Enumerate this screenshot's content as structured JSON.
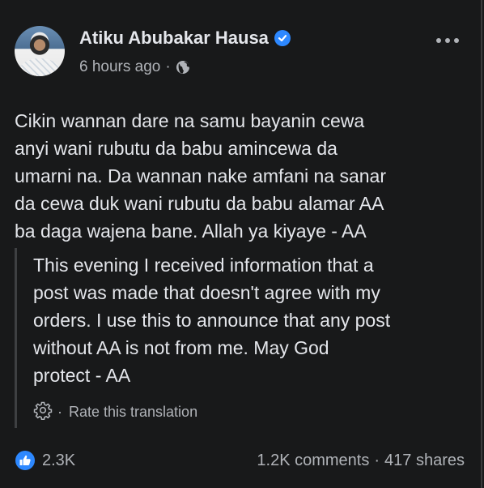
{
  "post": {
    "author": "Atiku Abubakar Hausa",
    "verified_icon": "verified-badge-icon",
    "time": "6 hours ago",
    "audience_icon": "globe-icon",
    "menu_icon": "more-options-icon",
    "text": "Cikin wannan dare na samu bayanin cewa\nanyi wani rubutu da babu amincewa da\numarni na. Da wannan nake amfani na sanar\nda cewa duk wani rubutu da babu alamar AA\nba daga wajena bane. Allah ya kiyaye - AA",
    "translation": {
      "text": "This evening I received information that a\npost was made that doesn't agree with my\norders. I use this to announce that any post\nwithout AA is not from me. May God\nprotect - AA",
      "rate_label": "Rate this translation",
      "rate_icon": "gear-icon"
    }
  },
  "footer": {
    "reaction_icon": "like-icon",
    "reactions": "2.3K",
    "comments": "1.2K comments",
    "shares": "417 shares"
  },
  "colors": {
    "background": "#18191a",
    "text": "#e4e6eb",
    "secondary": "#b0b3b8",
    "accent": "#2d88ff"
  },
  "separator": "·"
}
